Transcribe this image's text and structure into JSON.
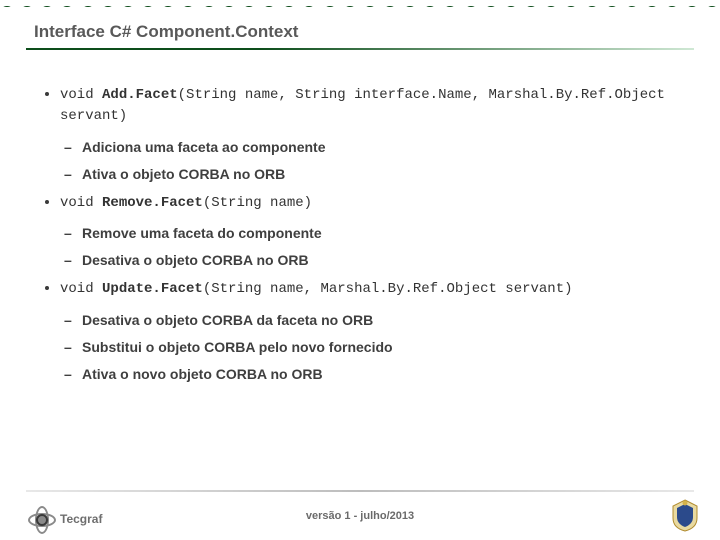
{
  "title": "Interface C# Component.Context",
  "items": [
    {
      "sig": {
        "ret": "void ",
        "name": "Add.Facet",
        "args": "(String name, String interface.Name, Marshal.By.Ref.Object servant)"
      },
      "subs": [
        "Adiciona uma faceta ao componente",
        "Ativa o objeto CORBA no ORB"
      ]
    },
    {
      "sig": {
        "ret": "void ",
        "name": "Remove.Facet",
        "args": "(String name)"
      },
      "subs": [
        "Remove uma faceta do componente",
        "Desativa o objeto CORBA no ORB"
      ]
    },
    {
      "sig": {
        "ret": "void ",
        "name": "Update.Facet",
        "args": "(String name, Marshal.By.Ref.Object servant)"
      },
      "subs": [
        "Desativa o objeto CORBA da faceta no ORB",
        "Substitui o objeto CORBA pelo novo fornecido",
        "Ativa o novo objeto CORBA no ORB"
      ]
    }
  ],
  "footer": "versão 1 - julho/2013",
  "logo_left_text": "Tecgraf",
  "colors": {
    "accent": "#0d4d1b"
  }
}
